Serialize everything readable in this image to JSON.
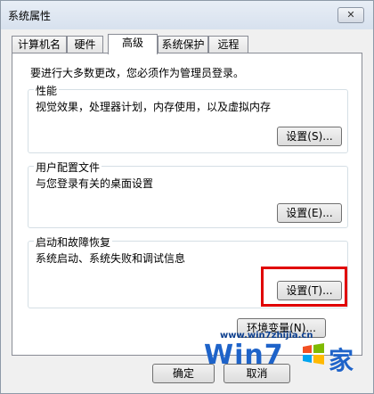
{
  "window": {
    "title": "系统属性",
    "close_glyph": "✕"
  },
  "tabs": [
    {
      "label": "计算机名",
      "active": false
    },
    {
      "label": "硬件",
      "active": false
    },
    {
      "label": "高级",
      "active": true
    },
    {
      "label": "系统保护",
      "active": false
    },
    {
      "label": "远程",
      "active": false
    }
  ],
  "notice": "要进行大多数更改，您必须作为管理员登录。",
  "groups": {
    "performance": {
      "title": "性能",
      "desc": "视觉效果，处理器计划，内存使用，以及虚拟内存",
      "button": "设置(S)..."
    },
    "profiles": {
      "title": "用户配置文件",
      "desc": "与您登录有关的桌面设置",
      "button": "设置(E)..."
    },
    "startup": {
      "title": "启动和故障恢复",
      "desc": "系统启动、系统失败和调试信息",
      "button": "设置(T)..."
    }
  },
  "env_button": "环境变量(N)...",
  "footer": {
    "ok": "确定",
    "cancel": "取消"
  },
  "watermark": {
    "url": "www.win7zhijia.cn",
    "brand": "Win7",
    "suffix": "家"
  },
  "colors": {
    "highlight": "#e00000",
    "watermark": "#1e63c9"
  },
  "icons": {
    "close": "close-icon",
    "watermark_flag": "windows-flag-icon"
  }
}
